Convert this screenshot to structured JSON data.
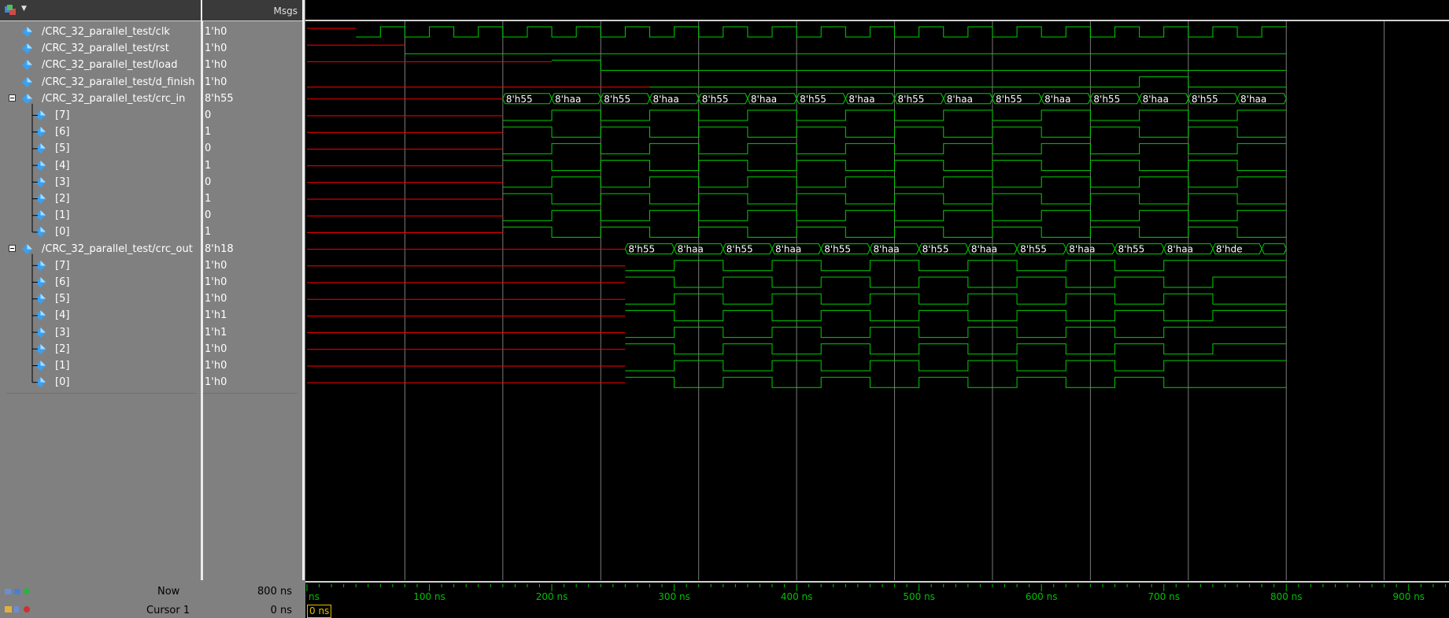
{
  "header": {
    "msgs_label": "Msgs"
  },
  "signals": [
    {
      "name": "/CRC_32_parallel_test/clk",
      "value": "1'h0",
      "level": 0,
      "expand": false
    },
    {
      "name": "/CRC_32_parallel_test/rst",
      "value": "1'h0",
      "level": 0,
      "expand": false
    },
    {
      "name": "/CRC_32_parallel_test/load",
      "value": "1'h0",
      "level": 0,
      "expand": false
    },
    {
      "name": "/CRC_32_parallel_test/d_finish",
      "value": "1'h0",
      "level": 0,
      "expand": false
    },
    {
      "name": "/CRC_32_parallel_test/crc_in",
      "value": "8'h55",
      "level": 0,
      "expand": true
    },
    {
      "name": "[7]",
      "value": "0",
      "level": 1
    },
    {
      "name": "[6]",
      "value": "1",
      "level": 1
    },
    {
      "name": "[5]",
      "value": "0",
      "level": 1
    },
    {
      "name": "[4]",
      "value": "1",
      "level": 1
    },
    {
      "name": "[3]",
      "value": "0",
      "level": 1
    },
    {
      "name": "[2]",
      "value": "1",
      "level": 1
    },
    {
      "name": "[1]",
      "value": "0",
      "level": 1
    },
    {
      "name": "[0]",
      "value": "1",
      "level": 1
    },
    {
      "name": "/CRC_32_parallel_test/crc_out",
      "value": "8'h18",
      "level": 0,
      "expand": true
    },
    {
      "name": "[7]",
      "value": "1'h0",
      "level": 1
    },
    {
      "name": "[6]",
      "value": "1'h0",
      "level": 1
    },
    {
      "name": "[5]",
      "value": "1'h0",
      "level": 1
    },
    {
      "name": "[4]",
      "value": "1'h1",
      "level": 1
    },
    {
      "name": "[3]",
      "value": "1'h1",
      "level": 1
    },
    {
      "name": "[2]",
      "value": "1'h0",
      "level": 1
    },
    {
      "name": "[1]",
      "value": "1'h0",
      "level": 1
    },
    {
      "name": "[0]",
      "value": "1'h0",
      "level": 1
    }
  ],
  "waves": {
    "time_end_ns": 800,
    "view_start_ns": 0,
    "view_end_ns": 935,
    "clk_period_ns": 40,
    "clk_start_ns": 40,
    "rst_high_until_ns": 80,
    "load_valid_from_ns": 0,
    "load_high": [
      [
        140,
        200
      ]
    ],
    "load_x_until_ns": 200,
    "d_finish_x_until_ns": 280,
    "d_finish_high": [
      [
        680,
        720
      ]
    ],
    "crc_in_x_until_ns": 160,
    "crc_in_values": [
      "8'h55",
      "8'haa",
      "8'h55",
      "8'haa",
      "8'h55",
      "8'haa",
      "8'h55",
      "8'haa",
      "8'h55",
      "8'haa",
      "8'h55",
      "8'haa",
      "8'h55",
      "8'haa",
      "8'h55",
      "8'haa"
    ],
    "crc_in_step_ns": 40,
    "crc_out_x_until_ns": 260,
    "crc_out_values": [
      "8'h55",
      "8'haa",
      "8'h55",
      "8'haa",
      "8'h55",
      "8'haa",
      "8'h55",
      "8'haa",
      "8'h55",
      "8'haa",
      "8'h55",
      "8'haa",
      "8'hde",
      ""
    ],
    "crc_out_step_ns": 40,
    "color_wave": "#00d000",
    "color_x": "#ff0000",
    "color_grid": "#7a7a7a"
  },
  "timeline": {
    "labels": [
      "ns",
      "100 ns",
      "200 ns",
      "300 ns",
      "400 ns",
      "500 ns",
      "600 ns",
      "700 ns",
      "800 ns",
      "900 ns"
    ]
  },
  "footer": {
    "now_label": "Now",
    "now_value": "800 ns",
    "cursor_label": "Cursor 1",
    "cursor_value": "0 ns",
    "cursor_box": "0 ns"
  }
}
